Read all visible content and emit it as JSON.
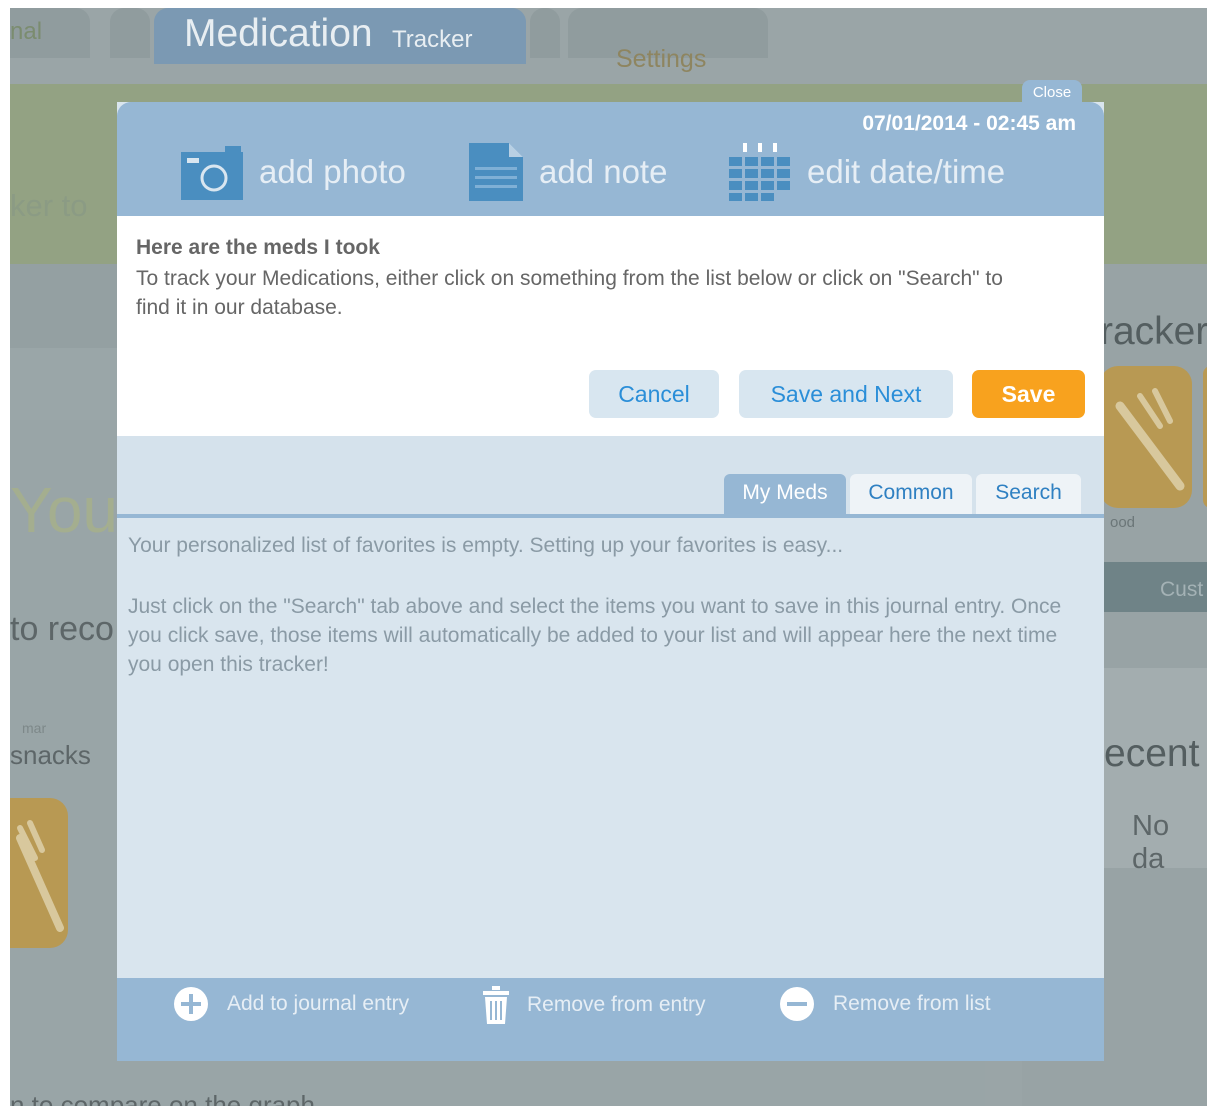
{
  "background": {
    "tabs": {
      "journal": "nal",
      "medication_main": "Medication",
      "medication_sub": "Tracker",
      "settings": "Settings"
    },
    "tracker_text": "ker to",
    "you": "You",
    "to_record": "to reco",
    "small_gray": "mar",
    "snacks": "snacks",
    "bottom_text": "n to compare on the graph",
    "right_heading": "racker",
    "food_label": "ood",
    "custom_label": "Cust",
    "recent_heading": "ecent",
    "no_data": "No da"
  },
  "modal": {
    "close_label": "Close",
    "datetime": "07/01/2014 - 02:45 am",
    "header_actions": {
      "add_photo": "add photo",
      "add_note": "add note",
      "edit_datetime": "edit date/time"
    },
    "intro_title": "Here are the meds I took",
    "intro_body": "To track your Medications, either click on something from the list below or click on \"Search\" to find it in our database.",
    "buttons": {
      "cancel": "Cancel",
      "save_and_next": "Save and Next",
      "save": "Save"
    },
    "tabs": {
      "my_meds": "My Meds",
      "common": "Common",
      "search": "Search"
    },
    "active_tab": "My Meds",
    "empty_message": "Your personalized list of favorites is empty. Setting up your favorites is easy...",
    "help_message": "Just click on the \"Search\" tab above and select the items you want to save in this journal entry. Once you click save, those items will automatically be added to your list and will appear here the next time you open this tracker!",
    "footer_actions": {
      "add_to_journal": "Add to journal entry",
      "remove_from_entry": "Remove from entry",
      "remove_from_list": "Remove from list"
    }
  },
  "colors": {
    "header_blue": "#96b7d4",
    "save_orange": "#f8a21e",
    "link_blue": "#2a8ed8",
    "overlay_gray": "#9aa5a7"
  }
}
